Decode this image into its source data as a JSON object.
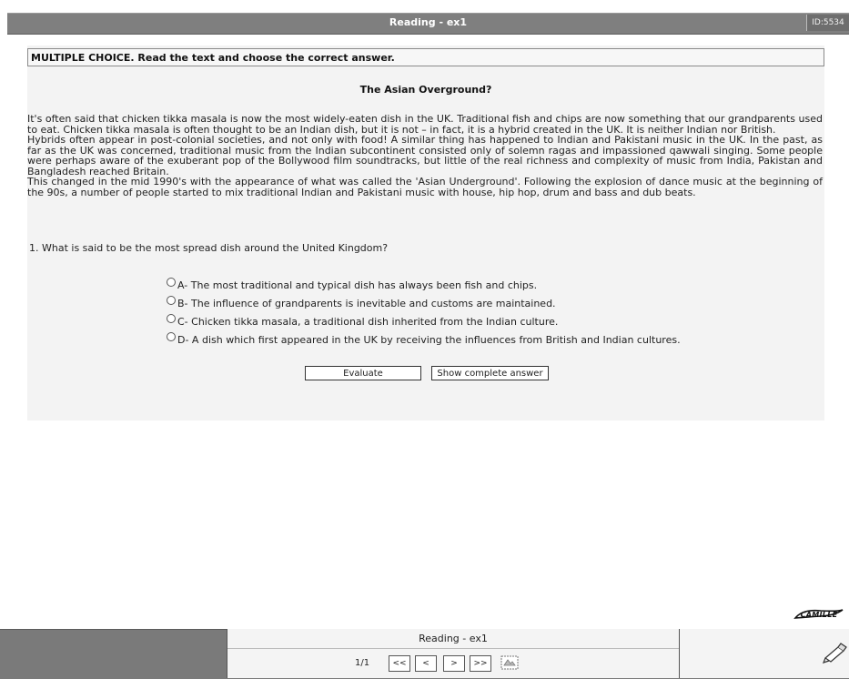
{
  "window": {
    "title": "Reading - ex1",
    "id_label": "ID:5534"
  },
  "instruction": "MULTIPLE CHOICE. Read the text and choose the correct answer.",
  "text_title": "The Asian Overground?",
  "passage": [
    "It's often said that chicken tikka masala is now the most widely-eaten dish in the UK. Traditional fish and chips are now something that our grandparents used to eat. Chicken tikka masala is often thought to be an Indian dish, but it is not – in fact, it is a hybrid created in the UK.  It is neither Indian nor British.",
    "Hybrids often appear in post-colonial societies, and not only with food!  A similar thing has happened to Indian and Pakistani music in the UK.  In the past, as far as the UK was concerned, traditional music from the Indian subcontinent consisted only of solemn ragas and impassioned qawwali singing.  Some people were perhaps aware of the exuberant pop of the Bollywood film soundtracks, but little of the real richness and complexity of music from India, Pakistan and Bangladesh reached Britain.",
    "This changed in the mid 1990's with the appearance of what was called the 'Asian Underground'.  Following the explosion of dance music at the beginning of the 90s, a number of people started to mix traditional Indian and Pakistani music with house, hip hop, drum and bass and dub beats."
  ],
  "question": "1. What is said to be the most spread dish around the United Kingdom?",
  "options": [
    "A- The most traditional and typical dish has always been fish and chips.",
    "B- The influence of grandparents is inevitable and customs are maintained.",
    "C- Chicken tikka masala, a traditional dish inherited from the Indian culture.",
    "D- A dish which first appeared in the UK by receiving the influences from British and Indian cultures."
  ],
  "buttons": {
    "evaluate": "Evaluate",
    "show_answer": "Show complete answer"
  },
  "logo": "CAMILLE",
  "footer": {
    "title": "Reading - ex1",
    "page": "1/1",
    "first": "<<",
    "prev": "<",
    "next": ">",
    "last": ">>"
  }
}
